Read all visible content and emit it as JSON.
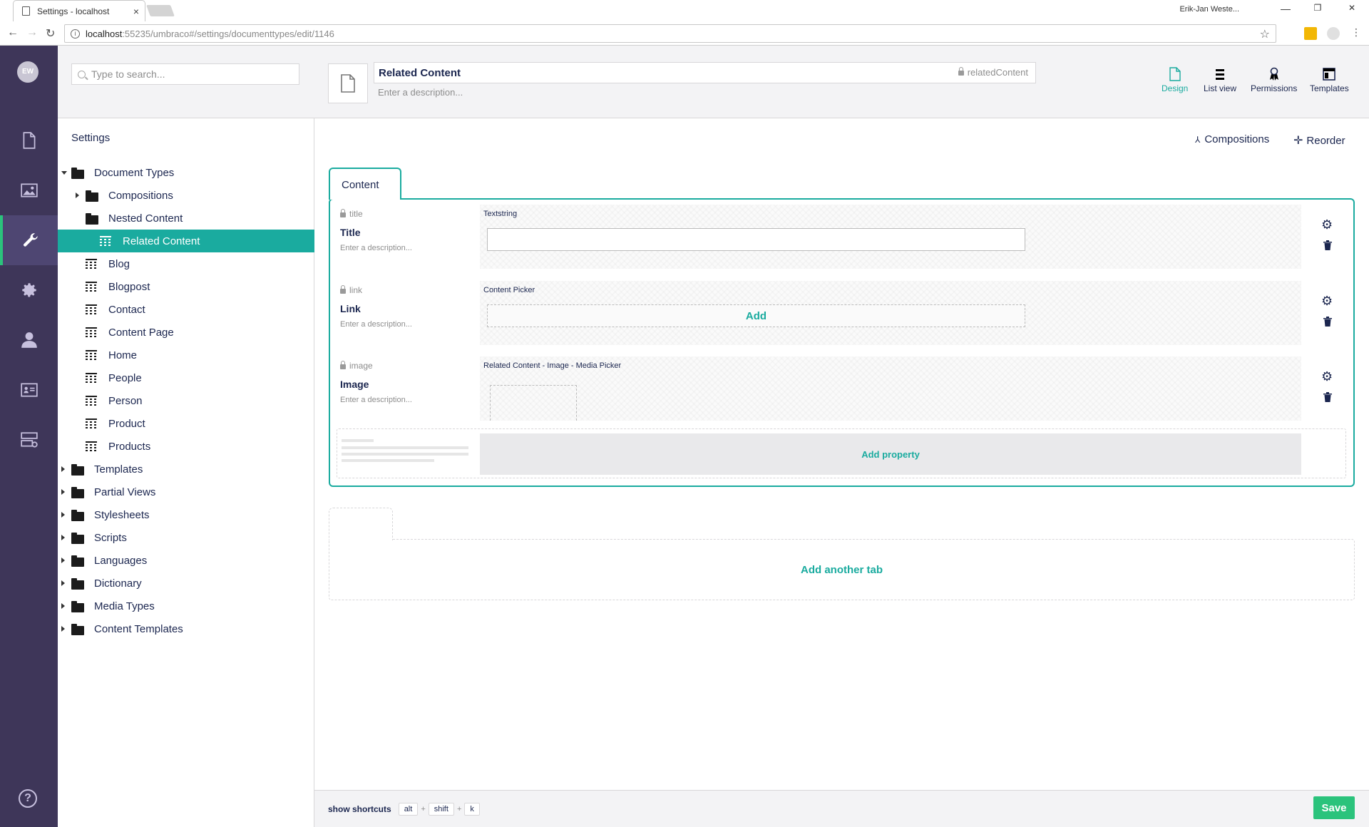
{
  "browser": {
    "tab_title": "Settings - localhost",
    "tab_close": "×",
    "user_name": "Erik-Jan Weste...",
    "url_host": "localhost",
    "url_path": ":55235/umbraco#/settings/documenttypes/edit/1146",
    "window_min": "—",
    "window_restore": "❐",
    "window_close": "✕"
  },
  "sections": {
    "avatar_initials": "EW",
    "items": [
      "content",
      "media",
      "settings",
      "developer",
      "users",
      "members",
      "forms"
    ],
    "active": "settings",
    "colors": {
      "background": "#3e3659",
      "active_bar": "#2bc37c"
    }
  },
  "tree": {
    "search_placeholder": "Type to search...",
    "title": "Settings",
    "nodes": [
      {
        "label": "Document Types"
      },
      {
        "label": "Compositions"
      },
      {
        "label": "Nested Content"
      },
      {
        "label": "Related Content"
      },
      {
        "label": "Blog"
      },
      {
        "label": "Blogpost"
      },
      {
        "label": "Contact"
      },
      {
        "label": "Content Page"
      },
      {
        "label": "Home"
      },
      {
        "label": "People"
      },
      {
        "label": "Person"
      },
      {
        "label": "Product"
      },
      {
        "label": "Products"
      },
      {
        "label": "Templates"
      },
      {
        "label": "Partial Views"
      },
      {
        "label": "Stylesheets"
      },
      {
        "label": "Scripts"
      },
      {
        "label": "Languages"
      },
      {
        "label": "Dictionary"
      },
      {
        "label": "Media Types"
      },
      {
        "label": "Content Templates"
      }
    ]
  },
  "editor": {
    "name": "Related Content",
    "alias": "relatedContent",
    "description_placeholder": "Enter a description...",
    "app_tabs": [
      "Design",
      "List view",
      "Permissions",
      "Templates"
    ],
    "active_app_tab": "Design",
    "compositions_label": "Compositions",
    "reorder_label": "Reorder",
    "group_name": "Content",
    "properties": [
      {
        "alias": "title",
        "name": "Title",
        "description": "Enter a description...",
        "editor": "Textstring"
      },
      {
        "alias": "link",
        "name": "Link",
        "description": "Enter a description...",
        "editor": "Content Picker",
        "add_label": "Add"
      },
      {
        "alias": "image",
        "name": "Image",
        "description": "Enter a description...",
        "editor": "Related Content - Image - Media Picker"
      }
    ],
    "add_property_label": "Add property",
    "add_tab_label": "Add another tab",
    "accent_color": "#1aab9f"
  },
  "footer": {
    "shortcuts_label": "show shortcuts",
    "keys": [
      "alt",
      "shift",
      "k"
    ],
    "save_label": "Save",
    "save_color": "#2bc37c"
  }
}
